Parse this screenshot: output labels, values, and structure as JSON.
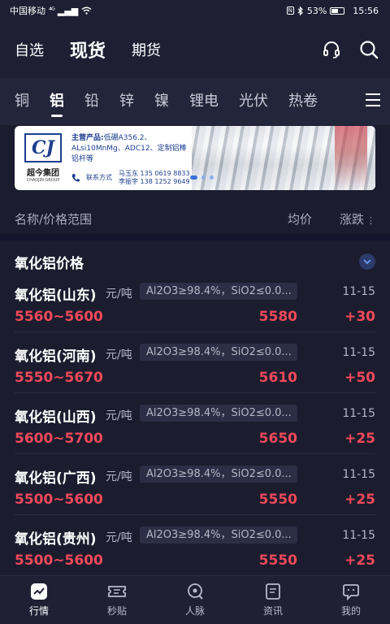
{
  "status": {
    "carrier": "中国移动",
    "signal": "⁴ᴳ",
    "battery": "53%",
    "time": "15:56",
    "nfc": "N"
  },
  "top_nav": {
    "tabs": [
      "自选",
      "现货",
      "期货"
    ],
    "active": 1
  },
  "categories": [
    "铜",
    "铝",
    "铅",
    "锌",
    "镍",
    "锂电",
    "光伏",
    "热卷"
  ],
  "banner": {
    "logo_mark": "CJ",
    "logo_cn": "超今集团",
    "logo_en": "CHAOJIN GROUP",
    "main_label": "主营产品:",
    "main_products": "低硼A356.2、ALsi10MnMg、ADC12、定制铝棒铝杆等",
    "contact_label": "联系方式",
    "contacts": [
      "马玉东 135 0619 8833",
      "李振宇 138 1252 9649"
    ]
  },
  "list_header": {
    "name": "名称/价格范围",
    "avg": "均价",
    "change": "涨跌"
  },
  "section": {
    "title": "氧化铝价格"
  },
  "rows": [
    {
      "name": "氧化铝(山东)",
      "unit": "元/吨",
      "spec": "Al2O3≥98.4%，SiO2≤0.0...",
      "date": "11-15",
      "range": "5560~5600",
      "avg": "5580",
      "change": "+30"
    },
    {
      "name": "氧化铝(河南)",
      "unit": "元/吨",
      "spec": "Al2O3≥98.4%，SiO2≤0.0...",
      "date": "11-15",
      "range": "5550~5670",
      "avg": "5610",
      "change": "+50"
    },
    {
      "name": "氧化铝(山西)",
      "unit": "元/吨",
      "spec": "Al2O3≥98.4%，SiO2≤0.0...",
      "date": "11-15",
      "range": "5600~5700",
      "avg": "5650",
      "change": "+25"
    },
    {
      "name": "氧化铝(广西)",
      "unit": "元/吨",
      "spec": "Al2O3≥98.4%，SiO2≤0.0...",
      "date": "11-15",
      "range": "5500~5600",
      "avg": "5550",
      "change": "+25"
    },
    {
      "name": "氧化铝(贵州)",
      "unit": "元/吨",
      "spec": "Al2O3≥98.4%，SiO2≤0.0...",
      "date": "11-15",
      "range": "5500~5600",
      "avg": "5550",
      "change": "+25"
    }
  ],
  "tabbar": [
    {
      "label": "行情",
      "icon": "market-chart-icon"
    },
    {
      "label": "秒贴",
      "icon": "ticket-icon"
    },
    {
      "label": "人脉",
      "icon": "contacts-search-icon"
    },
    {
      "label": "资讯",
      "icon": "news-doc-icon"
    },
    {
      "label": "我的",
      "icon": "profile-icon"
    }
  ],
  "colors": {
    "accent_red": "#f0495a",
    "background": "#1b1c2e",
    "cat_bar": "#23253a"
  }
}
